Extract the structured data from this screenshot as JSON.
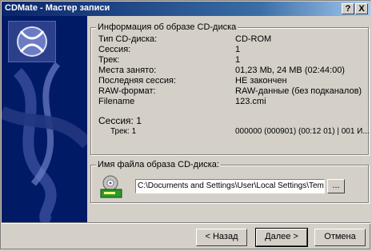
{
  "window": {
    "title": "CDMate - Мастер записи",
    "help_label": "?",
    "close_label": "X"
  },
  "info_group": {
    "legend": "Информация об образе CD-диска",
    "rows": [
      {
        "label": "Тип CD-диска:",
        "value": "CD-ROM"
      },
      {
        "label": "Сессия:",
        "value": "1"
      },
      {
        "label": "Трек:",
        "value": "1"
      },
      {
        "label": "Места занято:",
        "value": "01,23 Mb, 24 MB (02:44:00)"
      },
      {
        "label": "Последняя сессия:",
        "value": "НЕ закончен"
      },
      {
        "label": "RAW-формат:",
        "value": "RAW-данные (без подканалов)"
      },
      {
        "label": "Filename",
        "value": "123.cmi"
      }
    ],
    "session_header": "Сессия: 1",
    "track_label": "Трек: 1",
    "track_value": "000000 (000901) (00:12 01) | 001 И..."
  },
  "file_group": {
    "legend": "Имя файла образа CD-диска:",
    "path": "C:\\Documents and Settings\\User\\Local Settings\\Temp\\1",
    "browse_label": "...",
    "icon": "cd-drive-icon"
  },
  "buttons": {
    "back": "< Назад",
    "next": "Далее >",
    "cancel": "Отмена"
  }
}
